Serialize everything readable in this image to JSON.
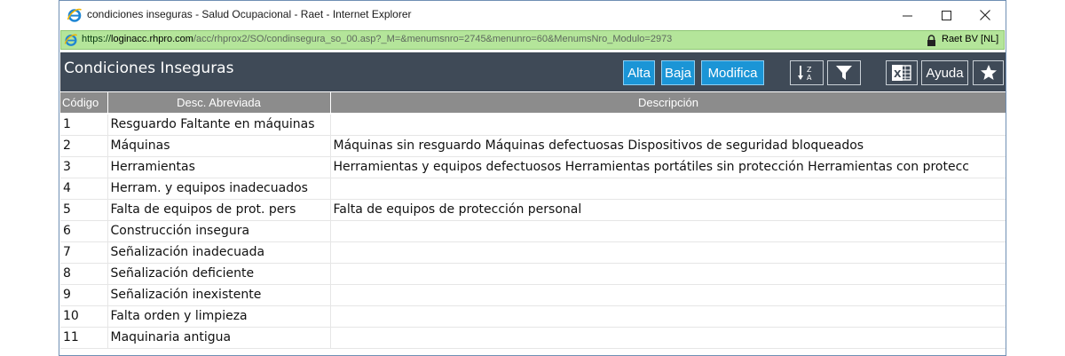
{
  "window": {
    "title": "condiciones inseguras - Salud Ocupacional - Raet - Internet Explorer"
  },
  "address": {
    "proto": "https://",
    "domain": "loginacc.rhpro.com",
    "path": "/acc/rhprox2/SO/condinsegura_so_00.asp?_M=&menumsnro=2745&menunro=60&MenumsNro_Modulo=2973",
    "cert": "Raet BV [NL]"
  },
  "header": {
    "title": "Condiciones Inseguras",
    "buttons": {
      "alta": "Alta",
      "baja": "Baja",
      "modifica": "Modifica",
      "ayuda": "Ayuda"
    }
  },
  "table": {
    "columns": [
      "Código",
      "Desc. Abreviada",
      "Descripción"
    ],
    "rows": [
      {
        "codigo": "1",
        "abreviada": "Resguardo Faltante en máquinas",
        "descripcion": ""
      },
      {
        "codigo": "2",
        "abreviada": "Máquinas",
        "descripcion": "Máquinas sin resguardo Máquinas defectuosas Dispositivos de seguridad bloqueados"
      },
      {
        "codigo": "3",
        "abreviada": "Herramientas",
        "descripcion": "Herramientas y equipos defectuosos Herramientas portátiles sin protección Herramientas con protecc"
      },
      {
        "codigo": "4",
        "abreviada": "Herram. y equipos inadecuados",
        "descripcion": ""
      },
      {
        "codigo": "5",
        "abreviada": "Falta de equipos de prot. pers",
        "descripcion": "Falta de equipos de protección personal"
      },
      {
        "codigo": "6",
        "abreviada": "Construcción insegura",
        "descripcion": ""
      },
      {
        "codigo": "7",
        "abreviada": "Señalización inadecuada",
        "descripcion": ""
      },
      {
        "codigo": "8",
        "abreviada": "Señalización deficiente",
        "descripcion": ""
      },
      {
        "codigo": "9",
        "abreviada": "Señalización inexistente",
        "descripcion": ""
      },
      {
        "codigo": "10",
        "abreviada": "Falta orden y limpieza",
        "descripcion": ""
      },
      {
        "codigo": "11",
        "abreviada": "Maquinaria antigua",
        "descripcion": ""
      }
    ]
  },
  "icons": {
    "browser": "internet-explorer-icon",
    "lock": "lock-icon",
    "sort": "sort-alpha-icon",
    "filter": "filter-icon",
    "excel": "excel-icon",
    "favorite": "star-icon"
  },
  "colors": {
    "header_bg": "#3f4a57",
    "button_blue": "#1b95d6",
    "address_bg": "#b4e59a",
    "table_header_bg": "#8c8c8c"
  }
}
